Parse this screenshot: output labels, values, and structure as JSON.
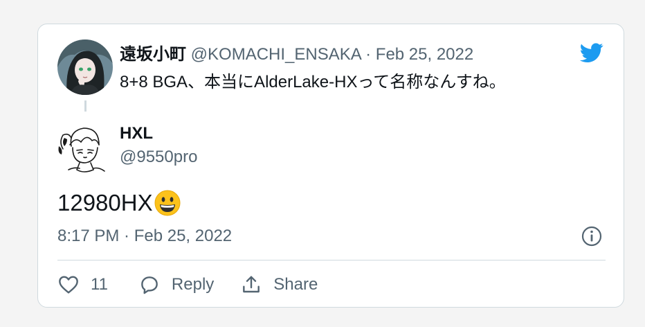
{
  "quoted_tweet": {
    "display_name": "遠坂小町",
    "handle": "@KOMACHI_ENSAKA",
    "separator": "·",
    "date": "Feb 25, 2022",
    "text": "8+8 BGA、本当にAlderLake-HXって名称なんすね。"
  },
  "reply_tweet": {
    "display_name": "HXL",
    "handle": "@9550pro",
    "text": "12980HX",
    "emoji": "grinning-face",
    "timestamp": "8:17 PM · Feb 25, 2022"
  },
  "actions": {
    "like_count": "11",
    "reply_label": "Reply",
    "share_label": "Share"
  },
  "icons": {
    "brand": "twitter-bird-icon",
    "info": "info-icon",
    "like": "heart-icon",
    "reply": "speech-bubble-icon",
    "share": "share-upload-icon"
  },
  "colors": {
    "brand": "#1d9bf0",
    "text": "#0f1419",
    "secondary": "#536471",
    "border": "#cfd9de"
  }
}
